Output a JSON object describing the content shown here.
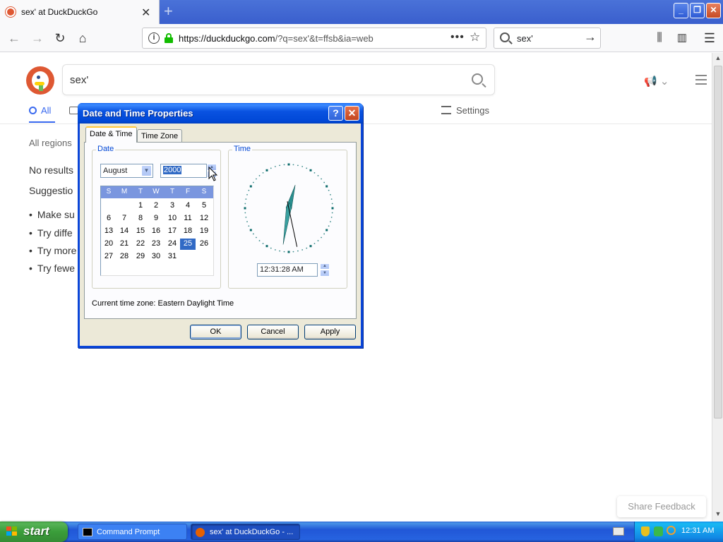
{
  "browser": {
    "tab_title": "sex' at DuckDuckGo",
    "url_host": "https://duckduckgo.com",
    "url_path": "/?q=sex'&t=ffsb&ia=web",
    "search_value": "sex'",
    "icons": [
      "back-icon",
      "forward-icon",
      "reload-icon",
      "home-icon",
      "library-icon",
      "sidebar-icon",
      "menu-icon"
    ]
  },
  "ddg": {
    "search_value": "sex'",
    "tab_all": "All",
    "settings": "Settings",
    "regions": "All regions",
    "no_results": "No results",
    "suggestions": "Suggestio",
    "items": [
      "Make su",
      "Try diffe",
      "Try more",
      "Try fewe"
    ],
    "share_feedback": "Share Feedback"
  },
  "dialog": {
    "title": "Date and Time Properties",
    "tabs": [
      "Date & Time",
      "Time Zone"
    ],
    "date_group": "Date",
    "time_group": "Time",
    "month": "August",
    "year": "2000",
    "weekday_headers": [
      "S",
      "M",
      "T",
      "W",
      "T",
      "F",
      "S"
    ],
    "calendar_days": [
      "",
      "",
      "1",
      "2",
      "3",
      "4",
      "5",
      "6",
      "7",
      "8",
      "9",
      "10",
      "11",
      "12",
      "13",
      "14",
      "15",
      "16",
      "17",
      "18",
      "19",
      "20",
      "21",
      "22",
      "23",
      "24",
      "25",
      "26",
      "27",
      "28",
      "29",
      "30",
      "31"
    ],
    "selected_day": "25",
    "time": "12:31:28 AM",
    "current_tz_label": "Current time zone:  Eastern Daylight Time",
    "ok": "OK",
    "cancel": "Cancel",
    "apply": "Apply",
    "accent": "#0a46d9",
    "selection": "#316ac5"
  },
  "taskbar": {
    "start": "start",
    "items": [
      "Command Prompt",
      "sex' at DuckDuckGo - ..."
    ],
    "clock": "12:31 AM"
  }
}
